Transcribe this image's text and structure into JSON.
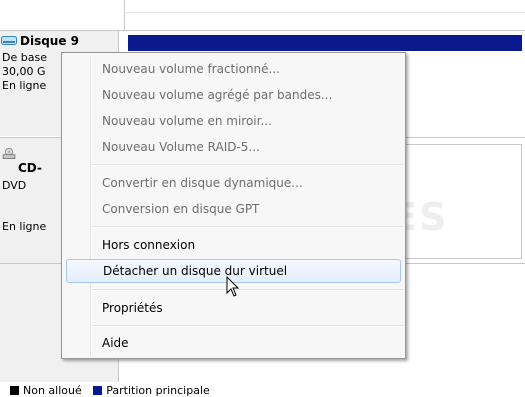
{
  "disks": [
    {
      "name": "Disque 9",
      "lines": [
        "De base",
        "30,00 G",
        "En ligne"
      ],
      "icon": "hard-disk-icon"
    },
    {
      "name": "CD-",
      "lines": [
        "DVD",
        "",
        "En ligne"
      ],
      "icon": "cd-drive-icon"
    }
  ],
  "context_menu": {
    "items": [
      {
        "label": "Nouveau volume fractionné...",
        "enabled": false
      },
      {
        "label": "Nouveau volume agrégé par bandes...",
        "enabled": false
      },
      {
        "label": "Nouveau volume en miroir...",
        "enabled": false
      },
      {
        "label": "Nouveau Volume RAID-5...",
        "enabled": false
      },
      {
        "label": "Convertir en disque dynamique...",
        "enabled": false
      },
      {
        "label": "Conversion en disque GPT",
        "enabled": false
      },
      {
        "label": "Hors connexion",
        "enabled": true
      },
      {
        "label": "Détacher un disque dur virtuel",
        "enabled": true,
        "hovered": true
      },
      {
        "label": "Propriétés",
        "enabled": true
      },
      {
        "label": "Aide",
        "enabled": true
      }
    ]
  },
  "legend": [
    {
      "label": "Non alloué",
      "color": "#000000"
    },
    {
      "label": "Partition principale",
      "color": "#0a1a8c"
    }
  ],
  "watermark": "PCASTUCES",
  "colors": {
    "partition_bar": "#0a1a8c",
    "menu_bg": "#f7f7f7",
    "disabled_text": "#6d6d6d"
  }
}
